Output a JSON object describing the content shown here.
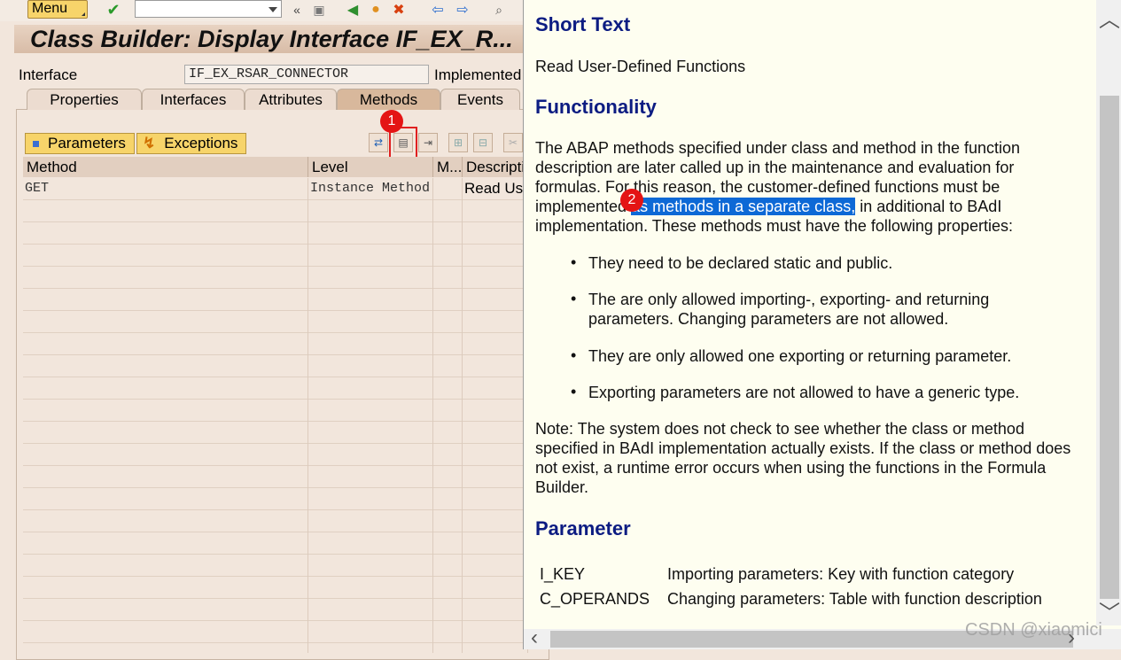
{
  "toolbar": {
    "menu_label": "Menu",
    "command_placeholder": ""
  },
  "title": "Class Builder: Display Interface IF_EX_R...",
  "header": {
    "interface_label": "Interface",
    "interface_value": "IF_EX_RSAR_CONNECTOR",
    "implemented_label": "Implemented"
  },
  "tabs": [
    {
      "label": "Properties"
    },
    {
      "label": "Interfaces"
    },
    {
      "label": "Attributes"
    },
    {
      "label": "Methods",
      "active": true
    },
    {
      "label": "Events"
    }
  ],
  "subtoolbar": {
    "parameters_label": "Parameters",
    "exceptions_label": "Exceptions"
  },
  "annotations": [
    "1",
    "2"
  ],
  "table": {
    "columns": [
      "Method",
      "Level",
      "M...",
      "Descripti"
    ],
    "rows": [
      {
        "method": "GET",
        "level": "Instance Method",
        "m": "",
        "description": "Read Us"
      }
    ]
  },
  "help": {
    "short_text_heading": "Short Text",
    "short_text": "Read User-Defined Functions",
    "functionality_heading": "Functionality",
    "func_para_a": "The ABAP methods specified under class and method in the function description are later called up in the maintenance and evaluation for formulas. For this reason, the customer-defined functions must be implemented ",
    "func_para_sel": "as methods in a separate class,",
    "func_para_b": " in additional to BAdI implementation. These methods must have the following properties:",
    "bullets": [
      "They need to be declared static and public.",
      "The are only allowed importing-, exporting- and returning parameters. Changing parameters are not allowed.",
      "They are only allowed one exporting or returning parameter.",
      "Exporting parameters are not allowed to have a generic type."
    ],
    "note": "Note: The system does not check to see whether the class or method specified in BAdI implementation actually exists. If the class or method does not exist, a runtime error occurs when using the functions in the Formula Builder.",
    "parameter_heading": "Parameter",
    "parameters": [
      {
        "name": "I_KEY",
        "desc": "Importing parameters: Key with function category"
      },
      {
        "name": "C_OPERANDS",
        "desc": "Changing parameters: Table with function description"
      }
    ]
  },
  "watermark": "CSDN @xiaomici",
  "colors": {
    "selection": "#0d69d6",
    "heading": "#0c1c82",
    "callout": "#e41414"
  }
}
